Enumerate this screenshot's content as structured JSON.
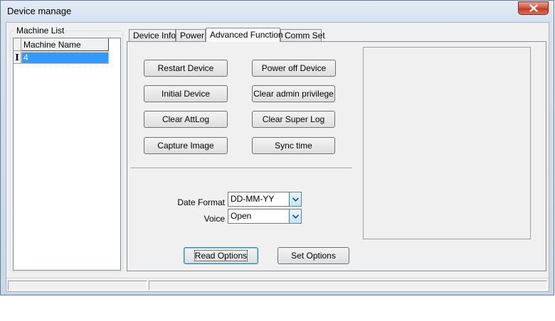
{
  "window": {
    "title": "Device manage"
  },
  "machine_list": {
    "group_label": "Machine List",
    "column_header": "Machine Name",
    "row_indicator": "I",
    "rows": [
      {
        "name": "4"
      }
    ]
  },
  "tabs": [
    {
      "label": "Device Info"
    },
    {
      "label": "Power"
    },
    {
      "label": "Advanced Function"
    },
    {
      "label": "Comm Set"
    }
  ],
  "advanced": {
    "buttons": {
      "restart_device": "Restart Device",
      "power_off_device": "Power off Device",
      "initial_device": "Initial Device",
      "clear_admin_privilege": "Clear admin privilege",
      "clear_attlog": "Clear AttLog",
      "clear_super_log": "Clear Super Log",
      "capture_image": "Capture Image",
      "sync_time": "Sync time",
      "read_options": "Read Options",
      "set_options": "Set Options"
    },
    "date_format": {
      "label": "Date Format",
      "value": "DD-MM-YY"
    },
    "voice": {
      "label": "Voice",
      "value": "Open"
    }
  },
  "icons": {
    "close": "close-icon",
    "dropdown": "chevron-down-icon",
    "row_pointer": "text-cursor-icon"
  },
  "colors": {
    "selection": "#3399ff",
    "close_button": "#c43c1f",
    "face": "#f0f0f0"
  }
}
